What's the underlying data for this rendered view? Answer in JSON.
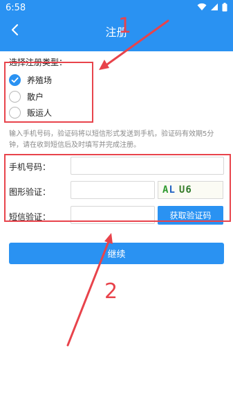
{
  "status_bar": {
    "time": "6:58"
  },
  "header": {
    "title": "注册"
  },
  "form": {
    "type_section_title": "选择注册类型：",
    "types": [
      {
        "label": "养殖场",
        "checked": true
      },
      {
        "label": "散户",
        "checked": false
      },
      {
        "label": "贩运人",
        "checked": false
      }
    ],
    "note": "输入手机号码，验证码将以短信形式发送到手机，验证码有效期5分钟，请在收到短信后及时填写并完成注册。",
    "phone_label": "手机号码：",
    "phone_value": "",
    "captcha_label": "图形验证：",
    "captcha_value": "",
    "captcha_image": {
      "chars": [
        "A",
        "L",
        "U",
        "6"
      ],
      "colors": [
        "#2f9a2f",
        "#1d5fc2",
        "#3a7d2a",
        "#2e7a2a"
      ]
    },
    "sms_label": "短信验证：",
    "sms_value": "",
    "sms_button": "获取验证码",
    "continue_button": "继续"
  },
  "annotations": {
    "label_1": "1",
    "label_2": "2",
    "color": "#e8434b"
  },
  "colors": {
    "primary": "#2a92f2"
  }
}
